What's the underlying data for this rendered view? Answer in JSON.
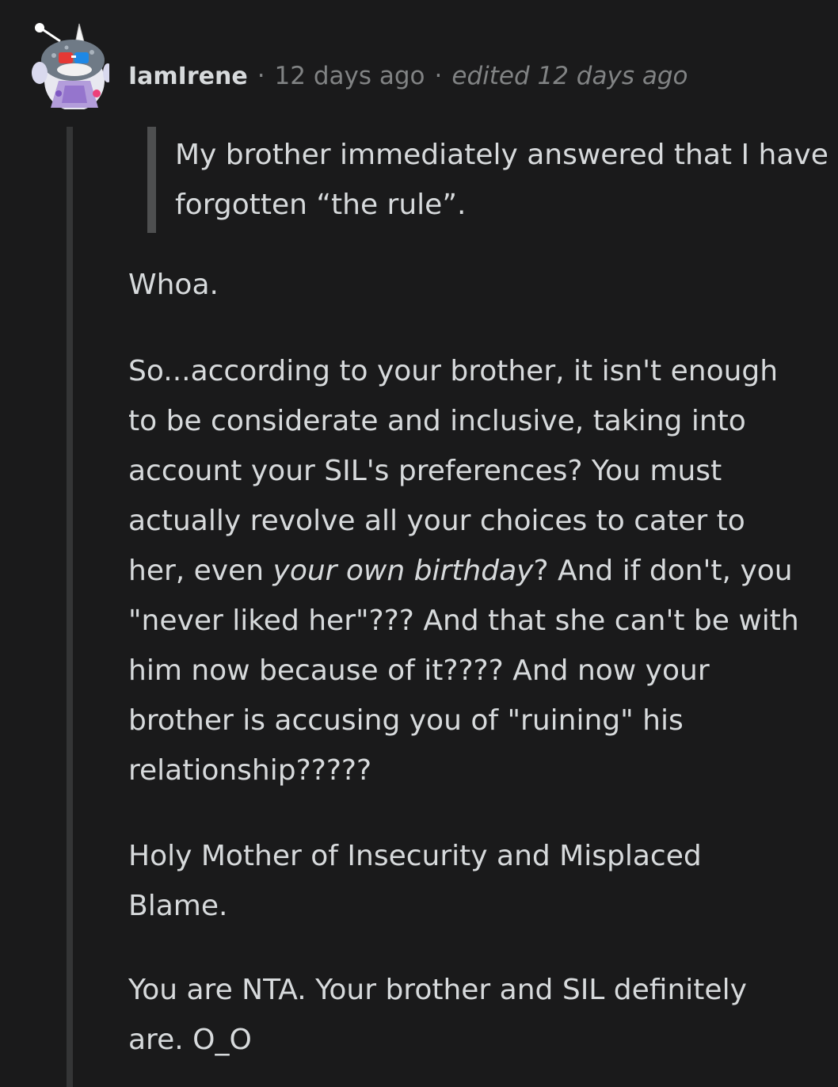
{
  "comment": {
    "avatar_icon": "snoo-avatar-icon",
    "username": "IamIrene",
    "separator": "·",
    "timestamp": "12 days ago",
    "edited": "edited 12 days ago",
    "quote": "My brother immediately answered that I have forgotten “the rule”.",
    "paragraphs": {
      "p1": "Whoa.",
      "p2_before": "So...according to your brother, it isn't enough to be considerate and inclusive, taking into account your SIL's preferences? You must actually revolve all your choices to cater to her, even ",
      "p2_emphasis": "your own birthday",
      "p2_after": "? And if don't, you \"never liked her\"??? And that she can't be with him now because of it???? And now your brother is accusing you of \"ruining\" his relationship?????",
      "p3": "Holy Mother of Insecurity and Misplaced Blame.",
      "p4": "You are NTA. Your brother and SIL definitely are. O_O"
    }
  },
  "colors": {
    "background": "#1a1a1b",
    "text": "#d7dadc",
    "meta_text": "#818384",
    "thread_line": "#343536",
    "quote_bar": "#4e4f50"
  }
}
